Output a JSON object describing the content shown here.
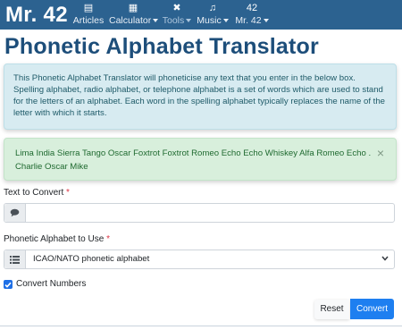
{
  "nav": {
    "brand": "Mr. 42",
    "items": [
      {
        "label": "Articles",
        "icon": "book-icon",
        "glyph": "▤",
        "dropdown": false
      },
      {
        "label": "Calculator",
        "icon": "calculator-icon",
        "glyph": "▦",
        "dropdown": true
      },
      {
        "label": "Tools",
        "icon": "tools-icon",
        "glyph": "✖",
        "dropdown": true
      },
      {
        "label": "Music",
        "icon": "music-note-icon",
        "glyph": "♫",
        "dropdown": true
      },
      {
        "label": "Mr. 42",
        "icon": "logo-42-icon",
        "glyph": "42",
        "dropdown": true
      }
    ]
  },
  "page": {
    "title": "Phonetic Alphabet Translator",
    "info_text": "This Phonetic Alphabet Translator will phoneticise any text that you enter in the below box. Spelling alphabet, radio alphabet, or telephone alphabet is a set of words which are used to stand for the letters of an alphabet. Each word in the spelling alphabet typically replaces the name of the letter with which it starts.",
    "result_text": "Lima India Sierra Tango Oscar Foxtrot Foxtrot Romeo Echo Echo Whiskey Alfa Romeo Echo . Charlie Oscar Mike",
    "close_glyph": "×"
  },
  "form": {
    "text_label": "Text to Convert",
    "required_mark": "*",
    "text_value": "",
    "text_placeholder": "",
    "alphabet_label": "Phonetic Alphabet to Use",
    "alphabet_value": "ICAO/NATO phonetic alphabet",
    "convert_numbers_label": "Convert Numbers",
    "convert_numbers_checked": true,
    "reset_label": "Reset",
    "convert_label": "Convert"
  },
  "colors": {
    "navbar": "#2c6290",
    "title": "#1d4e7a",
    "info_bg": "#d7ebf1",
    "success_bg": "#d8efdc",
    "primary": "#1e7ff0",
    "required": "#dc3545"
  }
}
